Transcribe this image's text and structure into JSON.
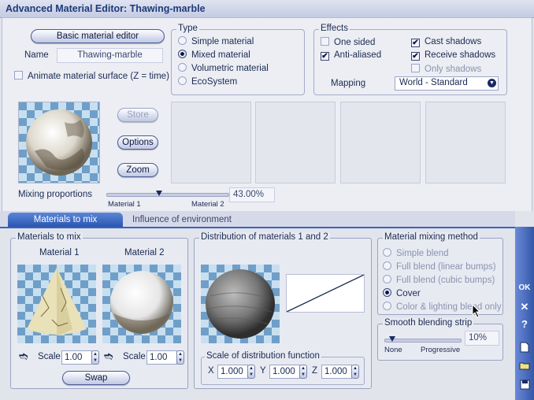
{
  "window": {
    "title": "Advanced Material Editor: Thawing-marble"
  },
  "top": {
    "basic_button": "Basic material editor",
    "name_label": "Name",
    "name_value": "Thawing-marble",
    "animate_label": "Animate material surface (Z = time)",
    "animate_checked": false
  },
  "type": {
    "title": "Type",
    "options": [
      "Simple material",
      "Mixed material",
      "Volumetric material",
      "EcoSystem"
    ],
    "selected": "Mixed material"
  },
  "effects": {
    "title": "Effects",
    "one_sided": "One sided",
    "anti_aliased": "Anti-aliased",
    "cast_shadows": "Cast shadows",
    "receive_shadows": "Receive shadows",
    "only_shadows": "Only shadows",
    "mapping_label": "Mapping",
    "mapping_value": "World - Standard"
  },
  "preview": {
    "store": "Store",
    "options": "Options",
    "zoom": "Zoom"
  },
  "mixing": {
    "label": "Mixing proportions",
    "left_label": "Material 1",
    "right_label": "Material 2",
    "value": "43.00%",
    "fraction": 0.43
  },
  "tabs": {
    "materials": "Materials to mix",
    "influence": "Influence of environment"
  },
  "mix": {
    "title": "Materials to mix",
    "mat1": "Material 1",
    "mat2": "Material 2",
    "scale_label": "Scale",
    "scale1": "1.00",
    "scale2": "1.00",
    "swap": "Swap"
  },
  "distribution": {
    "title": "Distribution of materials 1 and 2",
    "scale_title": "Scale of distribution function",
    "x_label": "X",
    "y_label": "Y",
    "z_label": "Z",
    "x": "1.000",
    "y": "1.000",
    "z": "1.000"
  },
  "method": {
    "title": "Material mixing method",
    "options": [
      "Simple blend",
      "Full blend (linear bumps)",
      "Full blend (cubic bumps)",
      "Cover",
      "Color & lighting blend only"
    ],
    "selected": "Cover"
  },
  "smooth": {
    "title": "Smooth blending strip",
    "left": "None",
    "right": "Progressive",
    "value": "10%",
    "fraction": 0.1
  },
  "side": {
    "ok": "OK",
    "close": "✕",
    "help": "?"
  }
}
